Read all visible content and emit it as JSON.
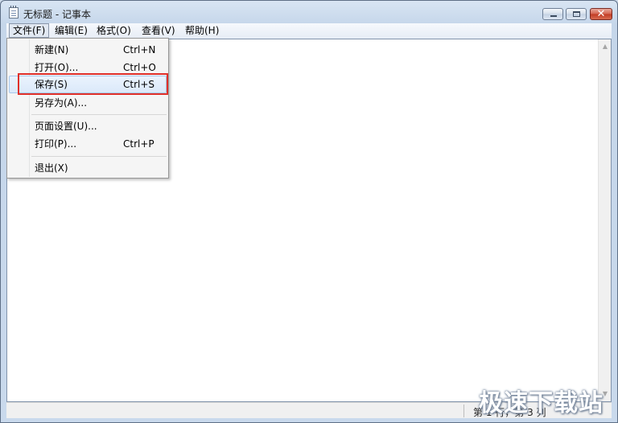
{
  "window": {
    "title": "无标题 - 记事本",
    "close_glyph": "✕"
  },
  "menubar": [
    {
      "label": "文件(F)"
    },
    {
      "label": "编辑(E)"
    },
    {
      "label": "格式(O)"
    },
    {
      "label": "查看(V)"
    },
    {
      "label": "帮助(H)"
    }
  ],
  "file_menu": [
    {
      "label": "新建(N)",
      "shortcut": "Ctrl+N"
    },
    {
      "label": "打开(O)...",
      "shortcut": "Ctrl+O"
    },
    {
      "label": "保存(S)",
      "shortcut": "Ctrl+S"
    },
    {
      "label": "另存为(A)...",
      "shortcut": ""
    },
    {
      "label": "页面设置(U)...",
      "shortcut": ""
    },
    {
      "label": "打印(P)...",
      "shortcut": "Ctrl+P"
    },
    {
      "label": "退出(X)",
      "shortcut": ""
    }
  ],
  "statusbar": {
    "position": "第 1 行，第 3 列"
  },
  "watermark": "极速下载站",
  "colors": {
    "highlight_box": "#e0302a",
    "selected_item": "#dbe9fa"
  }
}
